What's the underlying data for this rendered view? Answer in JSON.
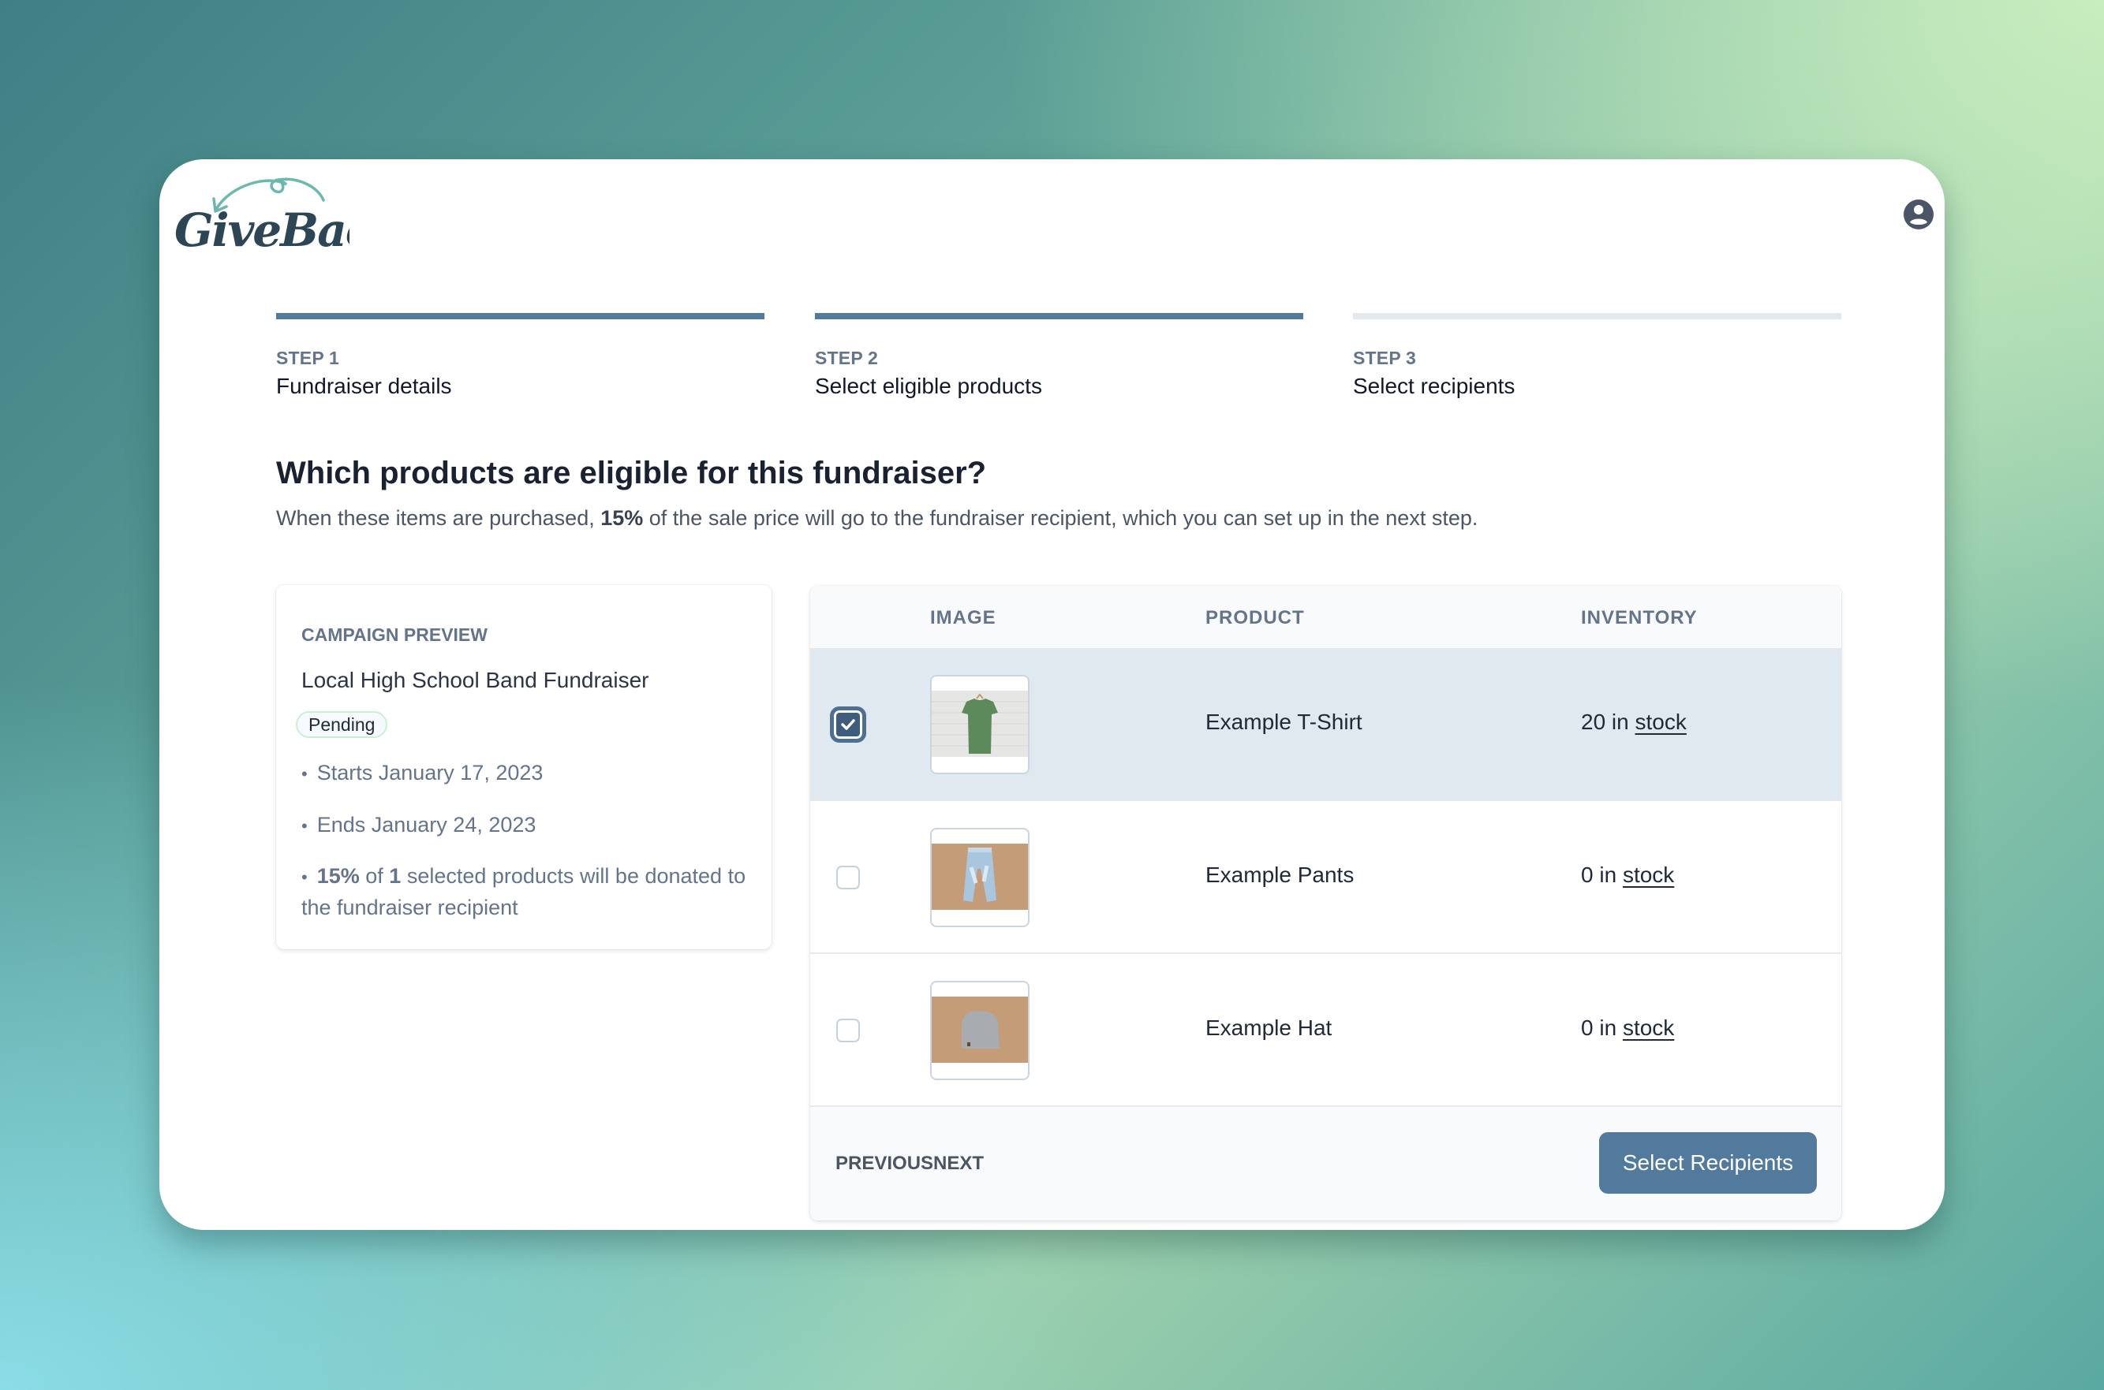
{
  "app": {
    "logo_text": "GiveBack",
    "brand_colors": {
      "primary": "#527a9c",
      "logo_dark": "#2d4656",
      "logo_accent": "#6db8ad"
    },
    "user_icon": "user-circle-icon"
  },
  "steps": [
    {
      "number": "STEP 1",
      "title": "Fundraiser details",
      "status": "complete"
    },
    {
      "number": "STEP 2",
      "title": "Select eligible products",
      "status": "current"
    },
    {
      "number": "STEP 3",
      "title": "Select recipients",
      "status": "upcoming"
    }
  ],
  "page": {
    "heading": "Which products are eligible for this fundraiser?",
    "subtext_before": "When these items are purchased, ",
    "subtext_percent": "15%",
    "subtext_after": " of the sale price will go to the fundraiser recipient, which you can set up in the next step."
  },
  "preview": {
    "label": "CAMPAIGN PREVIEW",
    "name": "Local High School Band Fundraiser",
    "status": "Pending",
    "starts": "Starts January 17, 2023",
    "ends": "Ends January 24, 2023",
    "donation_percent": "15%",
    "donation_of": " of ",
    "selected_count": "1",
    "donation_rest": " selected products will be donated to the fundraiser recipient"
  },
  "table": {
    "columns": [
      "",
      "IMAGE",
      "PRODUCT",
      "INVENTORY"
    ],
    "rows": [
      {
        "selected": true,
        "image": "green-tshirt-photo",
        "product": "Example T-Shirt",
        "inventory_count": "20 in ",
        "inventory_link": "stock"
      },
      {
        "selected": false,
        "image": "denim-pants-photo",
        "product": "Example Pants",
        "inventory_count": "0 in ",
        "inventory_link": "stock"
      },
      {
        "selected": false,
        "image": "grey-beanie-photo",
        "product": "Example Hat",
        "inventory_count": "0 in ",
        "inventory_link": "stock"
      }
    ],
    "previous_label": "PREVIOUS",
    "next_label": "NEXT",
    "primary_label": "Select Recipients"
  }
}
